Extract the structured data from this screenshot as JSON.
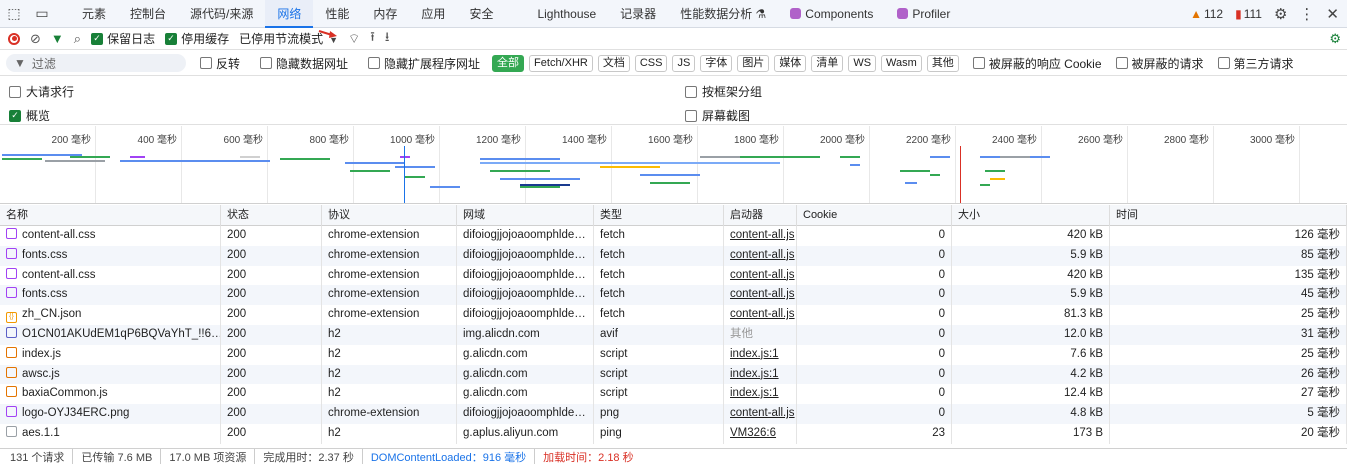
{
  "tabs": [
    "元素",
    "控制台",
    "源代码/来源",
    "网络",
    "性能",
    "内存",
    "应用",
    "安全",
    "Lighthouse",
    "记录器",
    "性能数据分析 ⚗",
    "Components",
    "Profiler"
  ],
  "active_tab_index": 3,
  "issues": {
    "warnings": "112",
    "errors": "111"
  },
  "toolbar": {
    "preserve_log": "保留日志",
    "disable_cache": "停用缓存",
    "throttling": "已停用节流模式"
  },
  "filter": {
    "placeholder": "过滤",
    "invert": "反转",
    "hide_data_urls": "隐藏数据网址",
    "hide_extension_urls": "隐藏扩展程序网址",
    "types": [
      "全部",
      "Fetch/XHR",
      "文档",
      "CSS",
      "JS",
      "字体",
      "图片",
      "媒体",
      "清单",
      "WS",
      "Wasm",
      "其他"
    ],
    "blocked_cookies": "被屏蔽的响应 Cookie",
    "blocked_requests": "被屏蔽的请求",
    "third_party": "第三方请求"
  },
  "options": {
    "big_rows": "大请求行",
    "overview": "概览",
    "group_by_frame": "按框架分组",
    "screenshots": "屏幕截图"
  },
  "overview_ticks": [
    "200 毫秒",
    "400 毫秒",
    "600 毫秒",
    "800 毫秒",
    "1000 毫秒",
    "1200 毫秒",
    "1400 毫秒",
    "1600 毫秒",
    "1800 毫秒",
    "2000 毫秒",
    "2200 毫秒",
    "2400 毫秒",
    "2600 毫秒",
    "2800 毫秒",
    "3000 毫秒"
  ],
  "columns": [
    "名称",
    "状态",
    "协议",
    "网域",
    "类型",
    "启动器",
    "Cookie",
    "大小",
    "时间"
  ],
  "rows": [
    {
      "name": "content-all.css",
      "status": "200",
      "protocol": "chrome-extension",
      "domain": "difoiogjjojoaoomphlde…",
      "type": "fetch",
      "initiator": "content-all.js",
      "cookie": "0",
      "size": "420 kB",
      "time": "126 毫秒",
      "icon": "css"
    },
    {
      "name": "fonts.css",
      "status": "200",
      "protocol": "chrome-extension",
      "domain": "difoiogjjojoaoomphlde…",
      "type": "fetch",
      "initiator": "content-all.js",
      "cookie": "0",
      "size": "5.9 kB",
      "time": "85 毫秒",
      "icon": "css"
    },
    {
      "name": "content-all.css",
      "status": "200",
      "protocol": "chrome-extension",
      "domain": "difoiogjjojoaoomphlde…",
      "type": "fetch",
      "initiator": "content-all.js",
      "cookie": "0",
      "size": "420 kB",
      "time": "135 毫秒",
      "icon": "css"
    },
    {
      "name": "fonts.css",
      "status": "200",
      "protocol": "chrome-extension",
      "domain": "difoiogjjojoaoomphlde…",
      "type": "fetch",
      "initiator": "content-all.js",
      "cookie": "0",
      "size": "5.9 kB",
      "time": "45 毫秒",
      "icon": "css"
    },
    {
      "name": "zh_CN.json",
      "status": "200",
      "protocol": "chrome-extension",
      "domain": "difoiogjjojoaoomphlde…",
      "type": "fetch",
      "initiator": "content-all.js",
      "cookie": "0",
      "size": "81.3 kB",
      "time": "25 毫秒",
      "icon": "json"
    },
    {
      "name": "O1CN01AKUdEM1qP6BQVaYhT_!!6…",
      "status": "200",
      "protocol": "h2",
      "domain": "img.alicdn.com",
      "type": "avif",
      "initiator": "其他",
      "cookie": "0",
      "size": "12.0 kB",
      "time": "31 毫秒",
      "icon": "img"
    },
    {
      "name": "index.js",
      "status": "200",
      "protocol": "h2",
      "domain": "g.alicdn.com",
      "type": "script",
      "initiator": "index.js:1",
      "cookie": "0",
      "size": "7.6 kB",
      "time": "25 毫秒",
      "icon": "js"
    },
    {
      "name": "awsc.js",
      "status": "200",
      "protocol": "h2",
      "domain": "g.alicdn.com",
      "type": "script",
      "initiator": "index.js:1",
      "cookie": "0",
      "size": "4.2 kB",
      "time": "26 毫秒",
      "icon": "js"
    },
    {
      "name": "baxiaCommon.js",
      "status": "200",
      "protocol": "h2",
      "domain": "g.alicdn.com",
      "type": "script",
      "initiator": "index.js:1",
      "cookie": "0",
      "size": "12.4 kB",
      "time": "27 毫秒",
      "icon": "js"
    },
    {
      "name": "logo-OYJ34ERC.png",
      "status": "200",
      "protocol": "chrome-extension",
      "domain": "difoiogjjojoaoomphlde…",
      "type": "png",
      "initiator": "content-all.js",
      "cookie": "0",
      "size": "4.8 kB",
      "time": "5 毫秒",
      "icon": "png"
    },
    {
      "name": "aes.1.1",
      "status": "200",
      "protocol": "h2",
      "domain": "g.aplus.aliyun.com",
      "type": "ping",
      "initiator": "VM326:6",
      "cookie": "23",
      "size": "173 B",
      "time": "20 毫秒",
      "icon": "ping"
    }
  ],
  "status": {
    "requests": "131 个请求",
    "transferred": "已传输 7.6 MB",
    "resources": "17.0 MB 项资源",
    "finish": "完成用时：2.37 秒",
    "dcl": "DOMContentLoaded：916 毫秒",
    "load": "加载时间：2.18 秒"
  },
  "colors": {
    "accent": "#1a73e8",
    "active_chip": "#34a853",
    "error": "#d93025",
    "checkbox": "#188038"
  }
}
